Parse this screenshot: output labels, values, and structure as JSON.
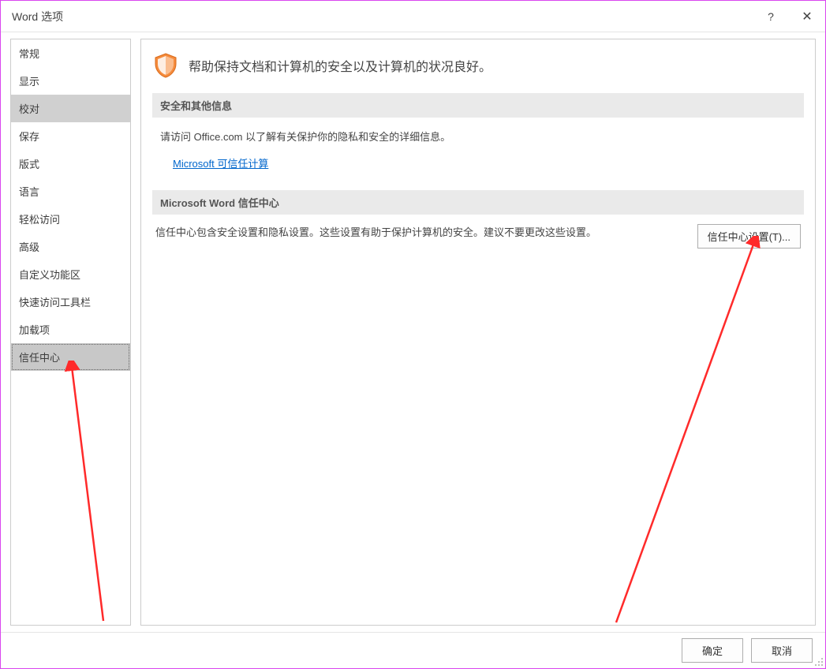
{
  "title": "Word 选项",
  "sidebar": {
    "items": [
      {
        "label": "常规"
      },
      {
        "label": "显示"
      },
      {
        "label": "校对"
      },
      {
        "label": "保存"
      },
      {
        "label": "版式"
      },
      {
        "label": "语言"
      },
      {
        "label": "轻松访问"
      },
      {
        "label": "高级"
      },
      {
        "label": "自定义功能区"
      },
      {
        "label": "快速访问工具栏"
      },
      {
        "label": "加载项"
      },
      {
        "label": "信任中心"
      }
    ]
  },
  "content": {
    "header": "帮助保持文档和计算机的安全以及计算机的状况良好。",
    "section1_title": "安全和其他信息",
    "section1_text": "请访问 Office.com 以了解有关保护你的隐私和安全的详细信息。",
    "link_text": "Microsoft 可信任计算",
    "section2_title": "Microsoft Word 信任中心",
    "section2_text": "信任中心包含安全设置和隐私设置。这些设置有助于保护计算机的安全。建议不要更改这些设置。",
    "trust_button": "信任中心设置(T)..."
  },
  "footer": {
    "ok": "确定",
    "cancel": "取消"
  },
  "help": "?"
}
